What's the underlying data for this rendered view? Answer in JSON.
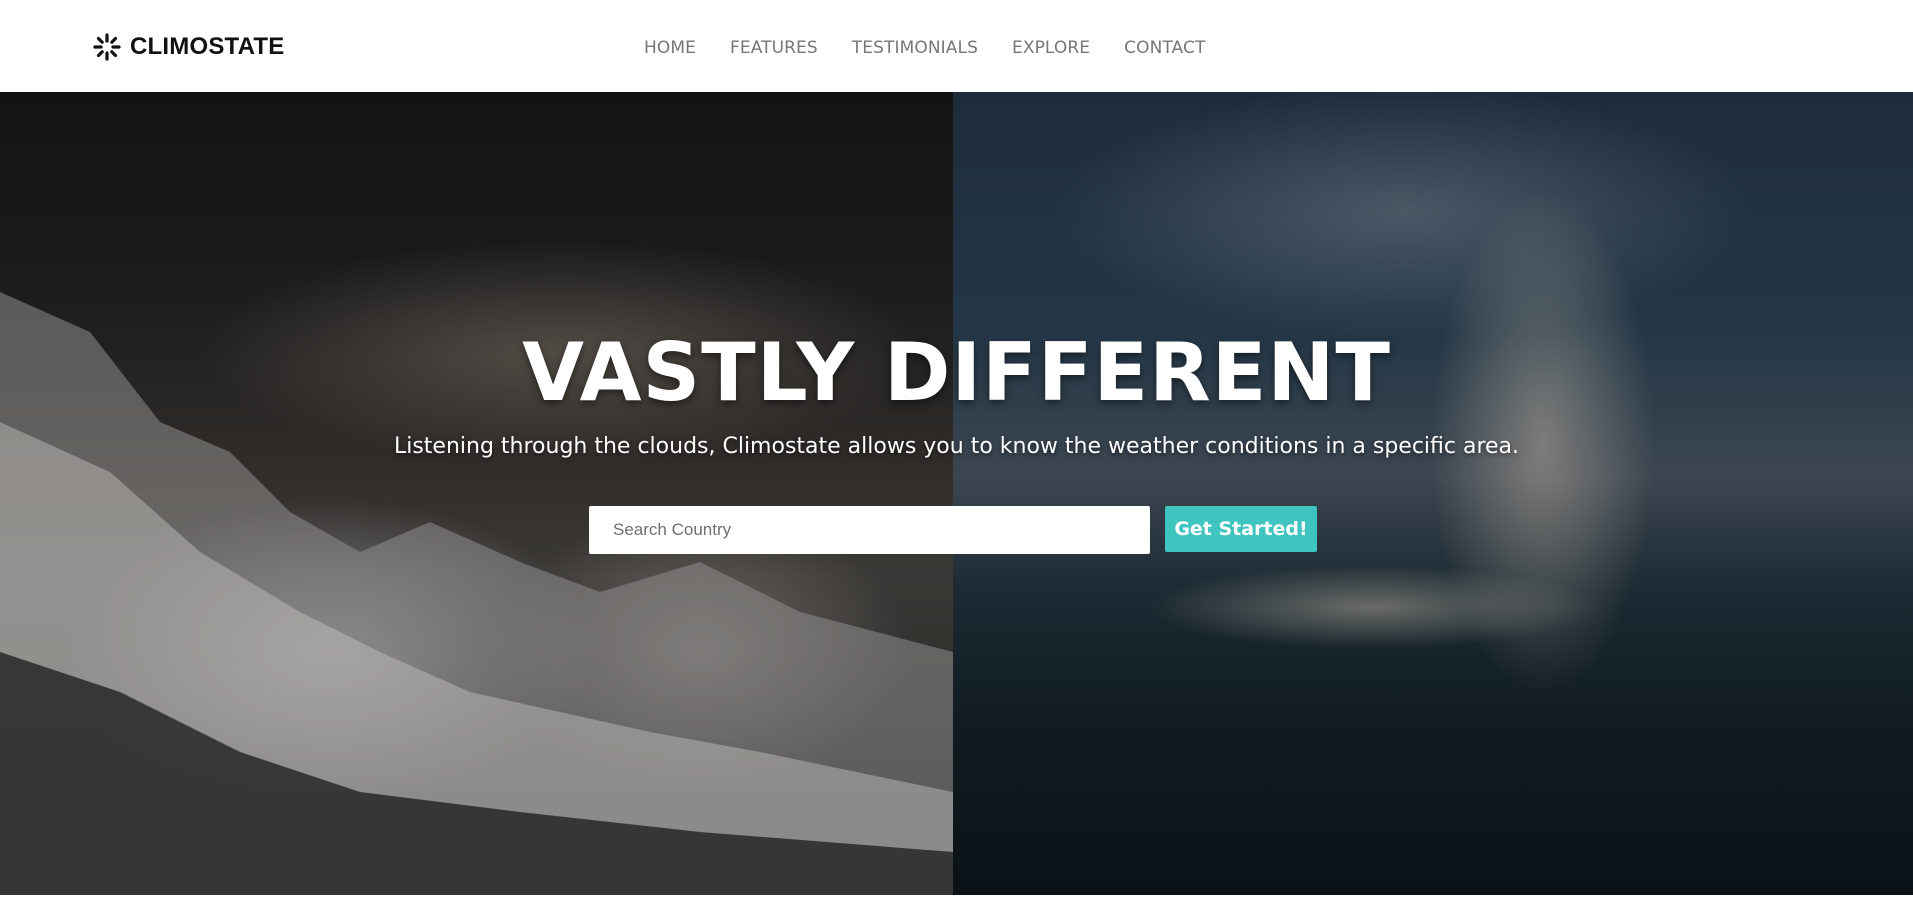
{
  "brand": {
    "name": "CLIMOSTATE",
    "icon": "loader-spinner-icon"
  },
  "nav": {
    "items": [
      {
        "label": "HOME"
      },
      {
        "label": "FEATURES"
      },
      {
        "label": "TESTIMONIALS"
      },
      {
        "label": "EXPLORE"
      },
      {
        "label": "CONTACT"
      }
    ]
  },
  "hero": {
    "title": "VASTLY DIFFERENT",
    "subtitle": "Listening through the clouds, Climostate allows you to know the weather conditions in a specific area.",
    "search_placeholder": "Search Country",
    "search_value": "",
    "cta_label": "Get Started!"
  },
  "colors": {
    "accent": "#3fc4c0",
    "nav_text": "#777777",
    "brand_text": "#111111"
  }
}
